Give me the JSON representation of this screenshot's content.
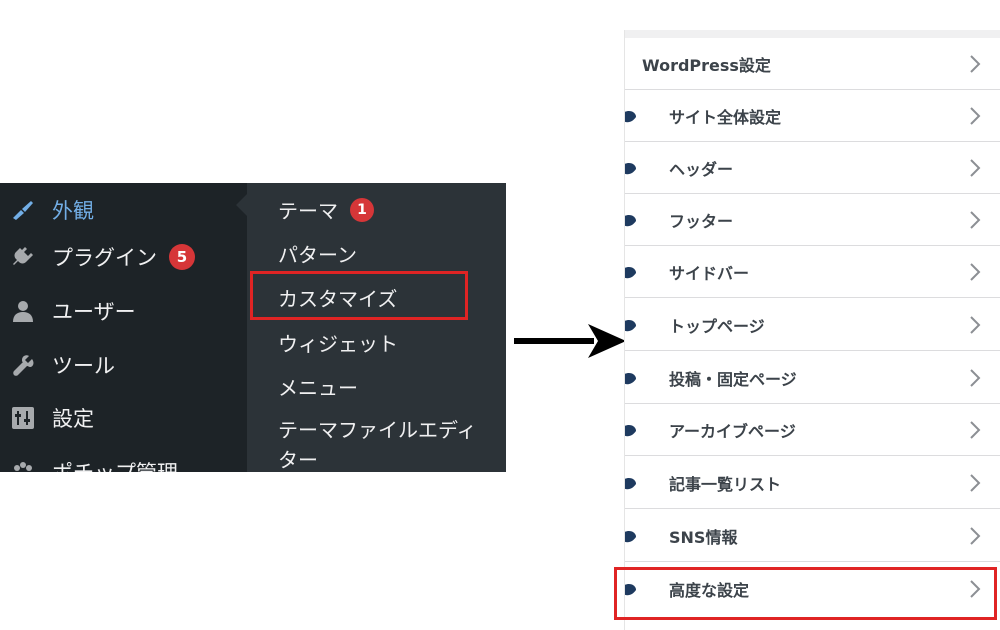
{
  "wp_admin": {
    "menu": [
      {
        "label": "外観",
        "icon": "paintbrush-icon",
        "current": true
      },
      {
        "label": "プラグイン",
        "icon": "plugin-icon",
        "badge": "5"
      },
      {
        "label": "ユーザー",
        "icon": "user-icon"
      },
      {
        "label": "ツール",
        "icon": "wrench-icon"
      },
      {
        "label": "設定",
        "icon": "settings-icon"
      },
      {
        "label": "ポチップ管理",
        "icon": "paw-icon"
      }
    ],
    "submenu": [
      {
        "label": "テーマ",
        "badge": "1"
      },
      {
        "label": "パターン"
      },
      {
        "label": "カスタマイズ",
        "highlighted": true
      },
      {
        "label": "ウィジェット"
      },
      {
        "label": "メニュー"
      },
      {
        "label": "テーマファイルエディター"
      }
    ]
  },
  "customizer": {
    "rows": [
      {
        "label": "WordPress設定"
      },
      {
        "label": "サイト全体設定"
      },
      {
        "label": "ヘッダー"
      },
      {
        "label": "フッター"
      },
      {
        "label": "サイドバー"
      },
      {
        "label": "トップページ"
      },
      {
        "label": "投稿・固定ページ"
      },
      {
        "label": "アーカイブページ"
      },
      {
        "label": "記事一覧リスト"
      },
      {
        "label": "SNS情報"
      },
      {
        "label": "高度な設定",
        "highlighted": true
      }
    ]
  },
  "colors": {
    "admin_bg": "#1d2327",
    "submenu_bg": "#2c3338",
    "current_link": "#72aee6",
    "badge": "#d63638",
    "highlight_border": "#e02424"
  }
}
